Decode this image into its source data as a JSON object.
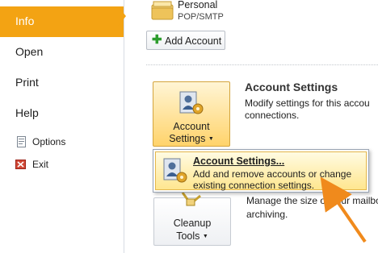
{
  "nav": {
    "items": [
      {
        "label": "Info",
        "active": true
      },
      {
        "label": "Open"
      },
      {
        "label": "Print"
      },
      {
        "label": "Help"
      },
      {
        "label": "Options",
        "icon": "options-icon"
      },
      {
        "label": "Exit",
        "icon": "exit-icon"
      }
    ]
  },
  "account": {
    "name": "Personal",
    "type": "POP/SMTP",
    "add_button": "Add Account"
  },
  "account_settings": {
    "button_line1": "Account",
    "button_line2": "Settings",
    "title": "Account Settings",
    "desc_line1": "Modify settings for this accou",
    "desc_line2": "connections."
  },
  "menu": {
    "item_title": "Account Settings...",
    "item_desc_line1": "Add and remove accounts or change",
    "item_desc_line2": "existing connection settings."
  },
  "cleanup": {
    "button_line1": "Cleanup",
    "button_line2": "Tools",
    "desc_line1": "Manage the size of your mailbo",
    "desc_line2": "archiving."
  },
  "colors": {
    "active_nav": "#f3a313",
    "button_highlight": "#ffd36b",
    "arrow": "#f08a1c"
  }
}
